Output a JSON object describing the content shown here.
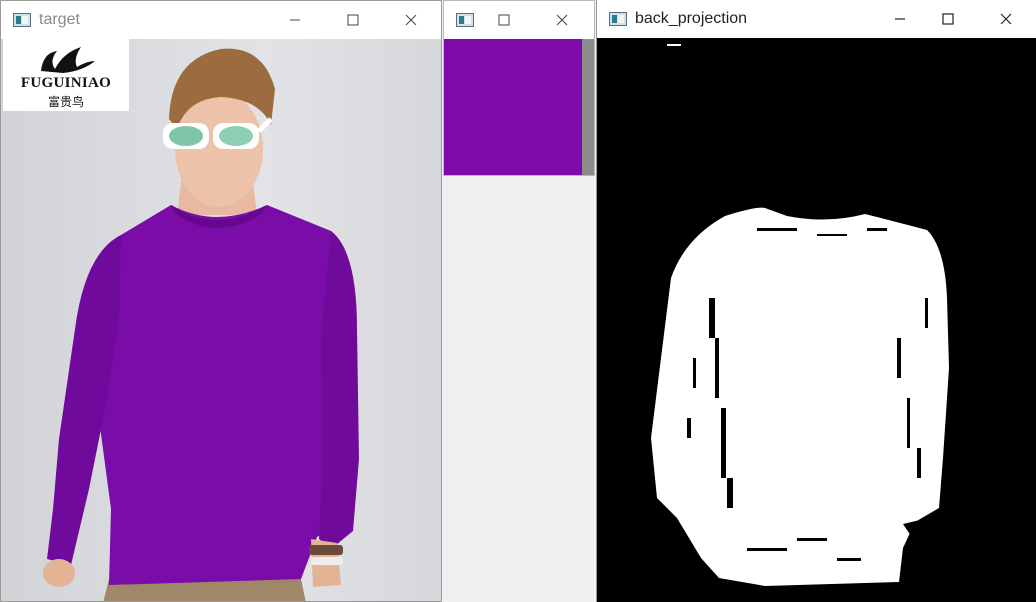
{
  "windows": {
    "target": {
      "title": "target",
      "logo": {
        "brand": "FUGUINIAO",
        "subtitle": "富贵鸟"
      }
    },
    "roi": {
      "title": ""
    },
    "back_projection": {
      "title": "back_projection"
    }
  },
  "colors": {
    "shirt_purple": "#7a0ca8",
    "backdrop": "#d7d8dc",
    "mask_white": "#ffffff",
    "mask_black": "#000000"
  },
  "icons": [
    "app-icon",
    "minimize-icon",
    "maximize-icon",
    "close-icon"
  ]
}
